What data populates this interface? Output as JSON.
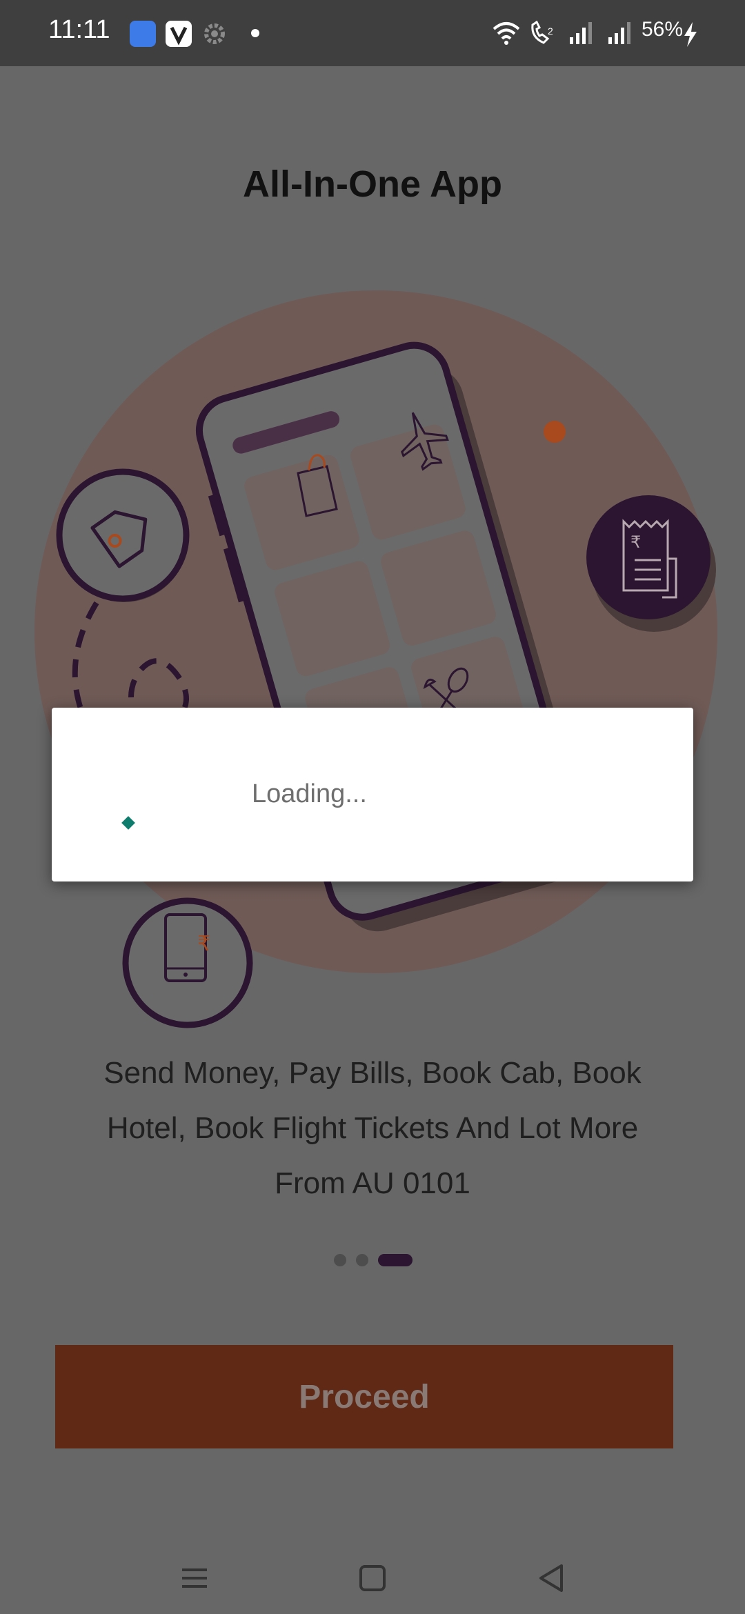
{
  "status_bar": {
    "time": "11:11",
    "battery": "56%"
  },
  "page": {
    "title": "All-In-One App",
    "description": "Send Money, Pay Bills, Book Cab, Book Hotel, Book Flight Tickets And Lot More From AU 0101",
    "carousel": {
      "total_pages": 3,
      "active_page": 3
    },
    "proceed_label": "Proceed"
  },
  "dialog": {
    "loading_text": "Loading..."
  },
  "colors": {
    "brand_dark": "#2b1530",
    "accent_orange": "#5f2916",
    "loader": "#0f7d6e"
  },
  "icons": [
    "shopping-bag-icon",
    "airplane-icon",
    "lotus-icon",
    "cutlery-icon",
    "price-tag-icon",
    "receipt-icon",
    "phone-rupee-icon"
  ]
}
